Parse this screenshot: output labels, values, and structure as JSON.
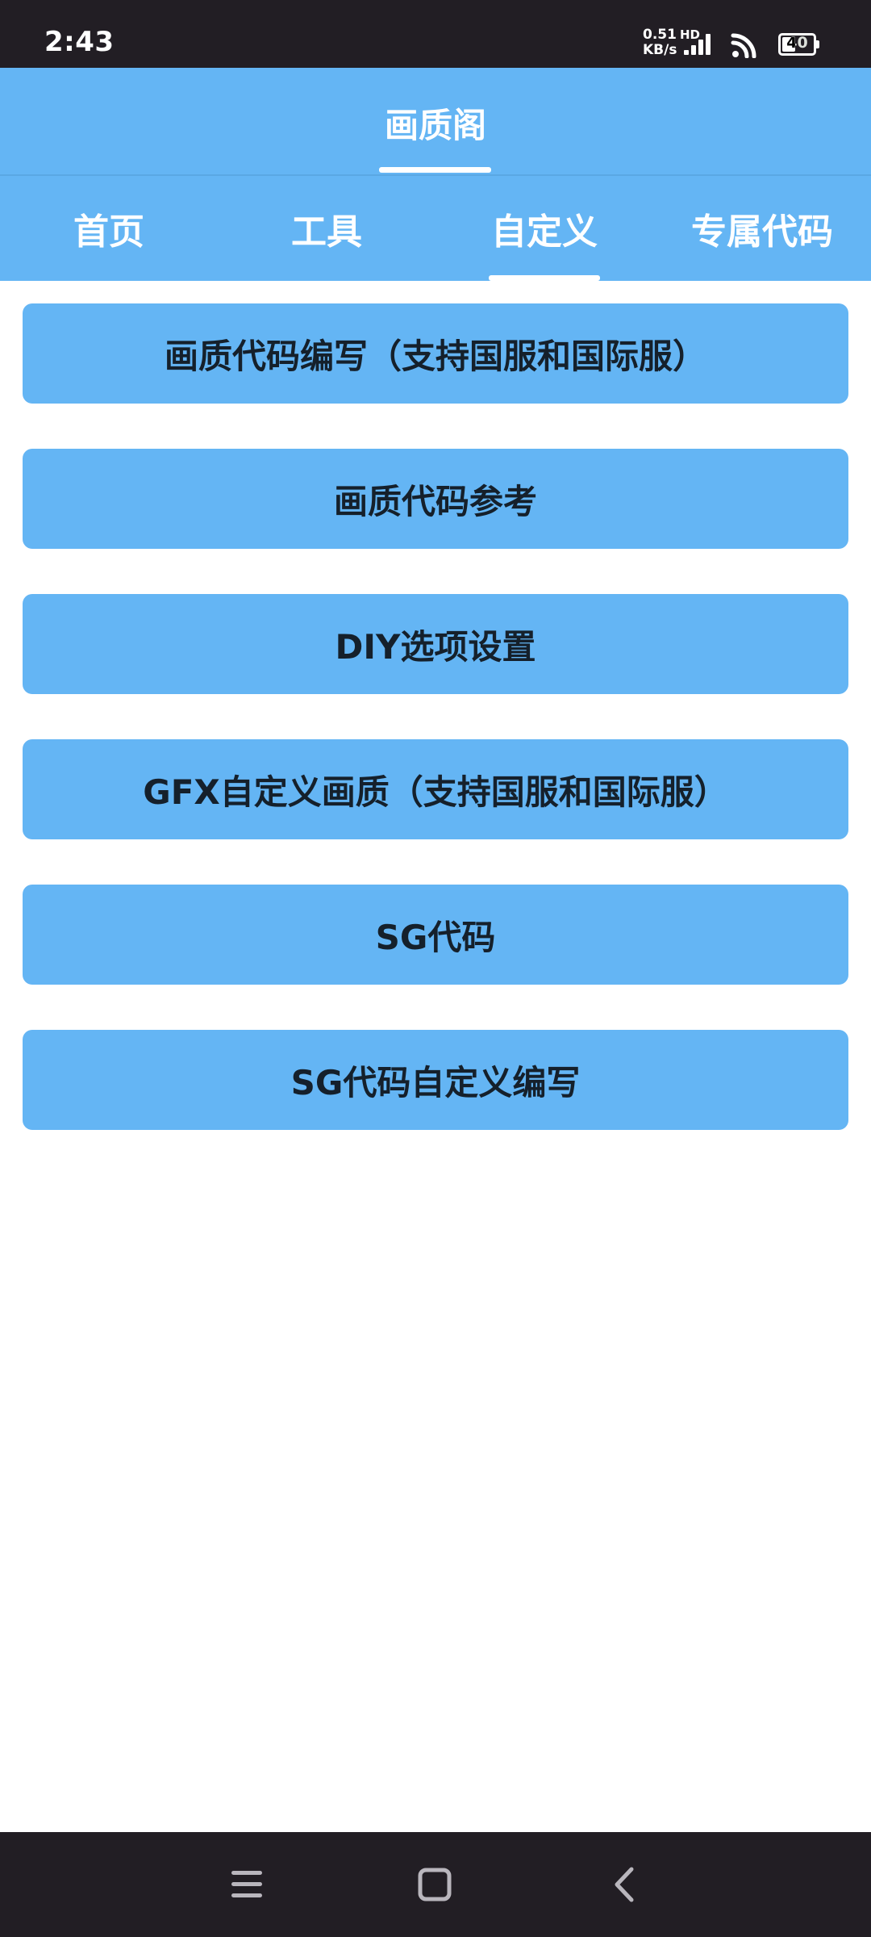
{
  "status_bar": {
    "time": "2:43",
    "net_speed_value": "0.51",
    "net_speed_unit": "KB/s",
    "hd_label": "HD",
    "battery_level": "40",
    "icons": [
      "signal-icon",
      "wifi-icon",
      "battery-icon"
    ]
  },
  "header": {
    "title": "画质阁"
  },
  "tabs": [
    {
      "label": "首页",
      "selected": false
    },
    {
      "label": "工具",
      "selected": false
    },
    {
      "label": "自定义",
      "selected": true
    },
    {
      "label": "专属代码",
      "selected": false
    }
  ],
  "menu": [
    {
      "label": "画质代码编写（支持国服和国际服）"
    },
    {
      "label": "画质代码参考"
    },
    {
      "label": "DIY选项设置"
    },
    {
      "label": "GFX自定义画质（支持国服和国际服）"
    },
    {
      "label": "SG代码"
    },
    {
      "label": "SG代码自定义编写"
    }
  ],
  "nav_bar": {
    "icons": [
      "menu-icon",
      "home-icon",
      "back-icon"
    ]
  },
  "colors": {
    "accent": "#64b5f4",
    "system_bar": "#221e24",
    "button_text": "#15202b"
  }
}
